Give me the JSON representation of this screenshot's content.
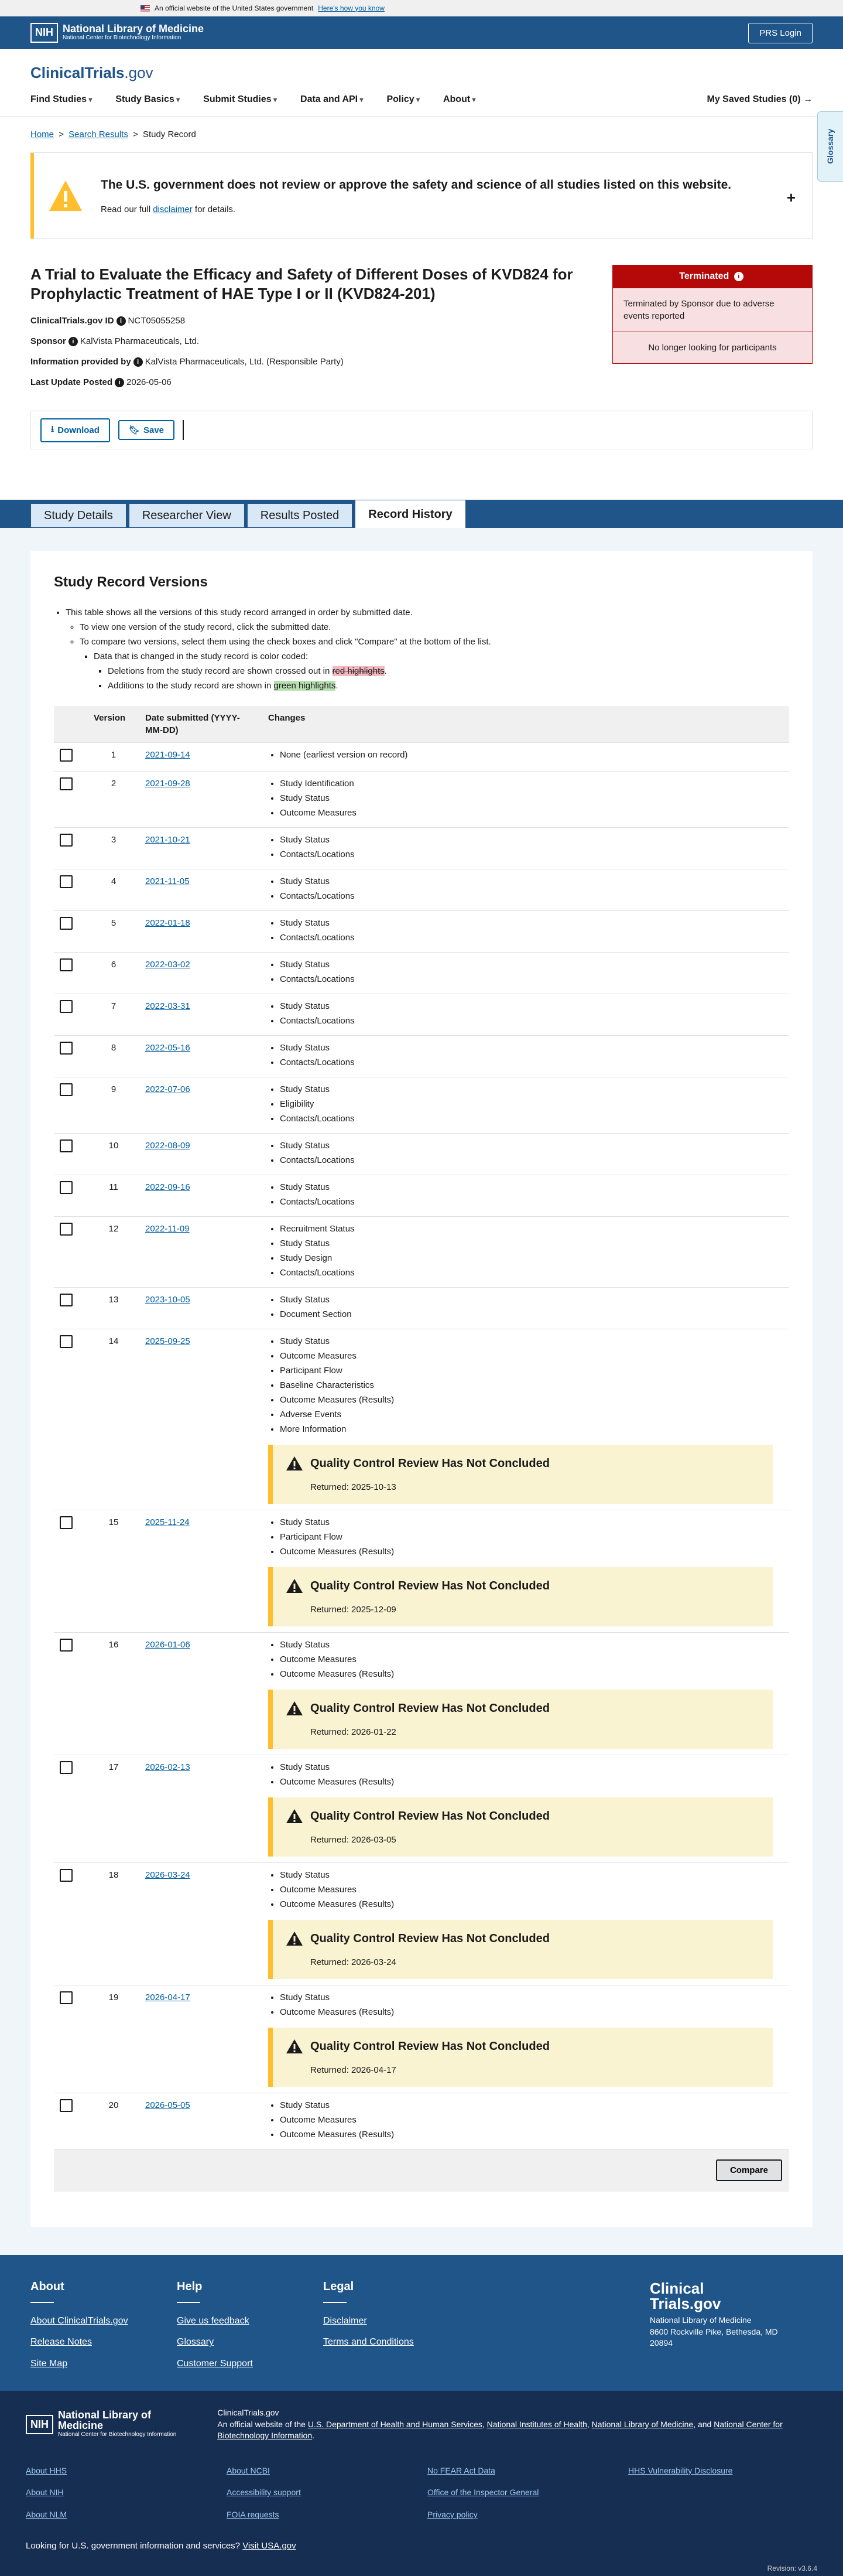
{
  "gov_banner": {
    "text": "An official website of the United States government",
    "link": "Here's how you know"
  },
  "nlm_bar": {
    "logo_box": "NIH",
    "title": "National Library of Medicine",
    "subtitle": "National Center for Biotechnology Information",
    "prs_button": "PRS Login"
  },
  "site": {
    "logo_main": "ClinicalTrials",
    "logo_suffix": ".gov"
  },
  "nav": {
    "items": [
      "Find Studies",
      "Study Basics",
      "Submit Studies",
      "Data and API",
      "Policy",
      "About"
    ],
    "saved": "My Saved Studies (0) →"
  },
  "glossary": "Glossary",
  "breadcrumb": {
    "home": "Home",
    "search": "Search Results",
    "sep": ">",
    "current": "Study Record"
  },
  "disclaimer": {
    "heading": "The U.S. government does not review or approve the safety and science of all studies listed on this website.",
    "text_pre": "Read our full ",
    "link": "disclaimer",
    "text_post": " for details.",
    "toggle": "+"
  },
  "study": {
    "title": "A Trial to Evaluate the Efficacy and Safety of Different Doses of KVD824 for Prophylactic Treatment of HAE Type I or II (KVD824-201)",
    "id_label": "ClinicalTrials.gov ID",
    "id_value": "NCT05055258",
    "sponsor_label": "Sponsor",
    "sponsor_value": "KalVista Pharmaceuticals, Ltd.",
    "info_label": "Information provided by",
    "info_value": "KalVista Pharmaceuticals, Ltd. (Responsible Party)",
    "update_label": "Last Update Posted",
    "update_value": "2026-05-06"
  },
  "status": {
    "heading": "Terminated",
    "reason": "Terminated by Sponsor due to adverse events reported",
    "recruit": "No longer looking for participants"
  },
  "actions": {
    "download": "Download",
    "save": "Save"
  },
  "tabs": [
    "Study Details",
    "Researcher View",
    "Results Posted",
    "Record History"
  ],
  "record": {
    "heading": "Study Record Versions",
    "intro1": "This table shows all the versions of this study record arranged in order by submitted date.",
    "intro2": "To view one version of the study record, click the submitted date.",
    "intro3": "To compare two versions, select them using the check boxes and click \"Compare\" at the bottom of the list.",
    "intro4": "Data that is changed in the study record is color coded:",
    "intro5_pre": "Deletions from the study record are shown crossed out in ",
    "intro5_hl": "red highlights",
    "intro6_pre": "Additions to the study record are shown in ",
    "intro6_hl": "green highlights",
    "dot": ".",
    "col_version": "Version",
    "col_date": "Date submitted (YYYY-MM-DD)",
    "col_changes": "Changes",
    "qc_title": "Quality Control Review Has Not Concluded",
    "compare": "Compare",
    "rows": [
      {
        "v": "1",
        "d": "2021-09-14",
        "c": [
          "None (earliest version on record)"
        ]
      },
      {
        "v": "2",
        "d": "2021-09-28",
        "c": [
          "Study Identification",
          "Study Status",
          "Outcome Measures"
        ]
      },
      {
        "v": "3",
        "d": "2021-10-21",
        "c": [
          "Study Status",
          "Contacts/Locations"
        ]
      },
      {
        "v": "4",
        "d": "2021-11-05",
        "c": [
          "Study Status",
          "Contacts/Locations"
        ]
      },
      {
        "v": "5",
        "d": "2022-01-18",
        "c": [
          "Study Status",
          "Contacts/Locations"
        ]
      },
      {
        "v": "6",
        "d": "2022-03-02",
        "c": [
          "Study Status",
          "Contacts/Locations"
        ]
      },
      {
        "v": "7",
        "d": "2022-03-31",
        "c": [
          "Study Status",
          "Contacts/Locations"
        ]
      },
      {
        "v": "8",
        "d": "2022-05-16",
        "c": [
          "Study Status",
          "Contacts/Locations"
        ]
      },
      {
        "v": "9",
        "d": "2022-07-06",
        "c": [
          "Study Status",
          "Eligibility",
          "Contacts/Locations"
        ]
      },
      {
        "v": "10",
        "d": "2022-08-09",
        "c": [
          "Study Status",
          "Contacts/Locations"
        ]
      },
      {
        "v": "11",
        "d": "2022-09-16",
        "c": [
          "Study Status",
          "Contacts/Locations"
        ]
      },
      {
        "v": "12",
        "d": "2022-11-09",
        "c": [
          "Recruitment Status",
          "Study Status",
          "Study Design",
          "Contacts/Locations"
        ]
      },
      {
        "v": "13",
        "d": "2023-10-05",
        "c": [
          "Study Status",
          "Document Section"
        ]
      },
      {
        "v": "14",
        "d": "2025-09-25",
        "c": [
          "Study Status",
          "Outcome Measures",
          "Participant Flow",
          "Baseline Characteristics",
          "Outcome Measures (Results)",
          "Adverse Events",
          "More Information"
        ],
        "qc": "Returned: 2025-10-13"
      },
      {
        "v": "15",
        "d": "2025-11-24",
        "c": [
          "Study Status",
          "Participant Flow",
          "Outcome Measures (Results)"
        ],
        "qc": "Returned: 2025-12-09"
      },
      {
        "v": "16",
        "d": "2026-01-06",
        "c": [
          "Study Status",
          "Outcome Measures",
          "Outcome Measures (Results)"
        ],
        "qc": "Returned: 2026-01-22"
      },
      {
        "v": "17",
        "d": "2026-02-13",
        "c": [
          "Study Status",
          "Outcome Measures (Results)"
        ],
        "qc": "Returned: 2026-03-05"
      },
      {
        "v": "18",
        "d": "2026-03-24",
        "c": [
          "Study Status",
          "Outcome Measures",
          "Outcome Measures (Results)"
        ],
        "qc": "Returned: 2026-03-24"
      },
      {
        "v": "19",
        "d": "2026-04-17",
        "c": [
          "Study Status",
          "Outcome Measures (Results)"
        ],
        "qc": "Returned: 2026-04-17"
      },
      {
        "v": "20",
        "d": "2026-05-05",
        "c": [
          "Study Status",
          "Outcome Measures",
          "Outcome Measures (Results)"
        ]
      }
    ]
  },
  "footer": {
    "about": {
      "h": "About",
      "links": [
        "About ClinicalTrials.gov",
        "Release Notes",
        "Site Map"
      ]
    },
    "help": {
      "h": "Help",
      "links": [
        "Give us feedback",
        "Glossary",
        "Customer Support"
      ]
    },
    "legal": {
      "h": "Legal",
      "links": [
        "Disclaimer",
        "Terms and Conditions"
      ]
    },
    "logo_line1": "Clinical",
    "logo_line2": "Trials.gov",
    "addr1": "National Library of Medicine",
    "addr2": "8600 Rockville Pike, Bethesda, MD",
    "addr3": "20894"
  },
  "footer_nlm": {
    "logo_box": "NIH",
    "title": "National Library of Medicine",
    "subtitle": "National Center for Biotechnology Information",
    "ct": "ClinicalTrials.gov",
    "line_pre": "An official website of the ",
    "l1": "U.S. Department of Health and Human Services",
    "l2": "National Institutes of Health",
    "l3": "National Library of Medicine",
    "l4": "National Center for Biotechnology Information",
    "comma": ", ",
    "and": ", and ",
    "period": ".",
    "links": [
      "About HHS",
      "About NCBI",
      "No FEAR Act Data",
      "HHS Vulnerability Disclosure",
      "About NIH",
      "Accessibility support",
      "Office of the Inspector General",
      "",
      "About NLM",
      "FOIA requests",
      "Privacy policy",
      ""
    ],
    "usa_pre": "Looking for U.S. government information and services? ",
    "usa_link": "Visit USA.gov",
    "revision": "Revision: v3.6.4"
  }
}
